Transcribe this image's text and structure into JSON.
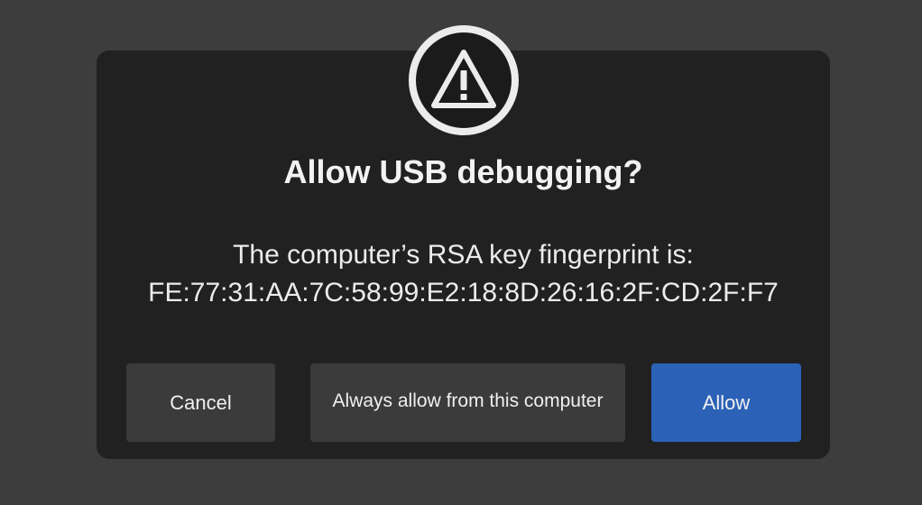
{
  "dialog": {
    "title": "Allow USB debugging?",
    "message_line1": "The computer’s RSA key fingerprint is:",
    "fingerprint": "FE:77:31:AA:7C:58:99:E2:18:8D:26:16:2F:CD:2F:F7",
    "icon": "warning-icon"
  },
  "buttons": {
    "cancel_label": "Cancel",
    "always_allow_label": "Always allow from this computer",
    "allow_label": "Allow"
  },
  "colors": {
    "background": "#3d3d3d",
    "dialog": "#212121",
    "secondary_button": "#3b3b3b",
    "primary_button": "#2b62b8",
    "text": "#f0f0f0"
  }
}
